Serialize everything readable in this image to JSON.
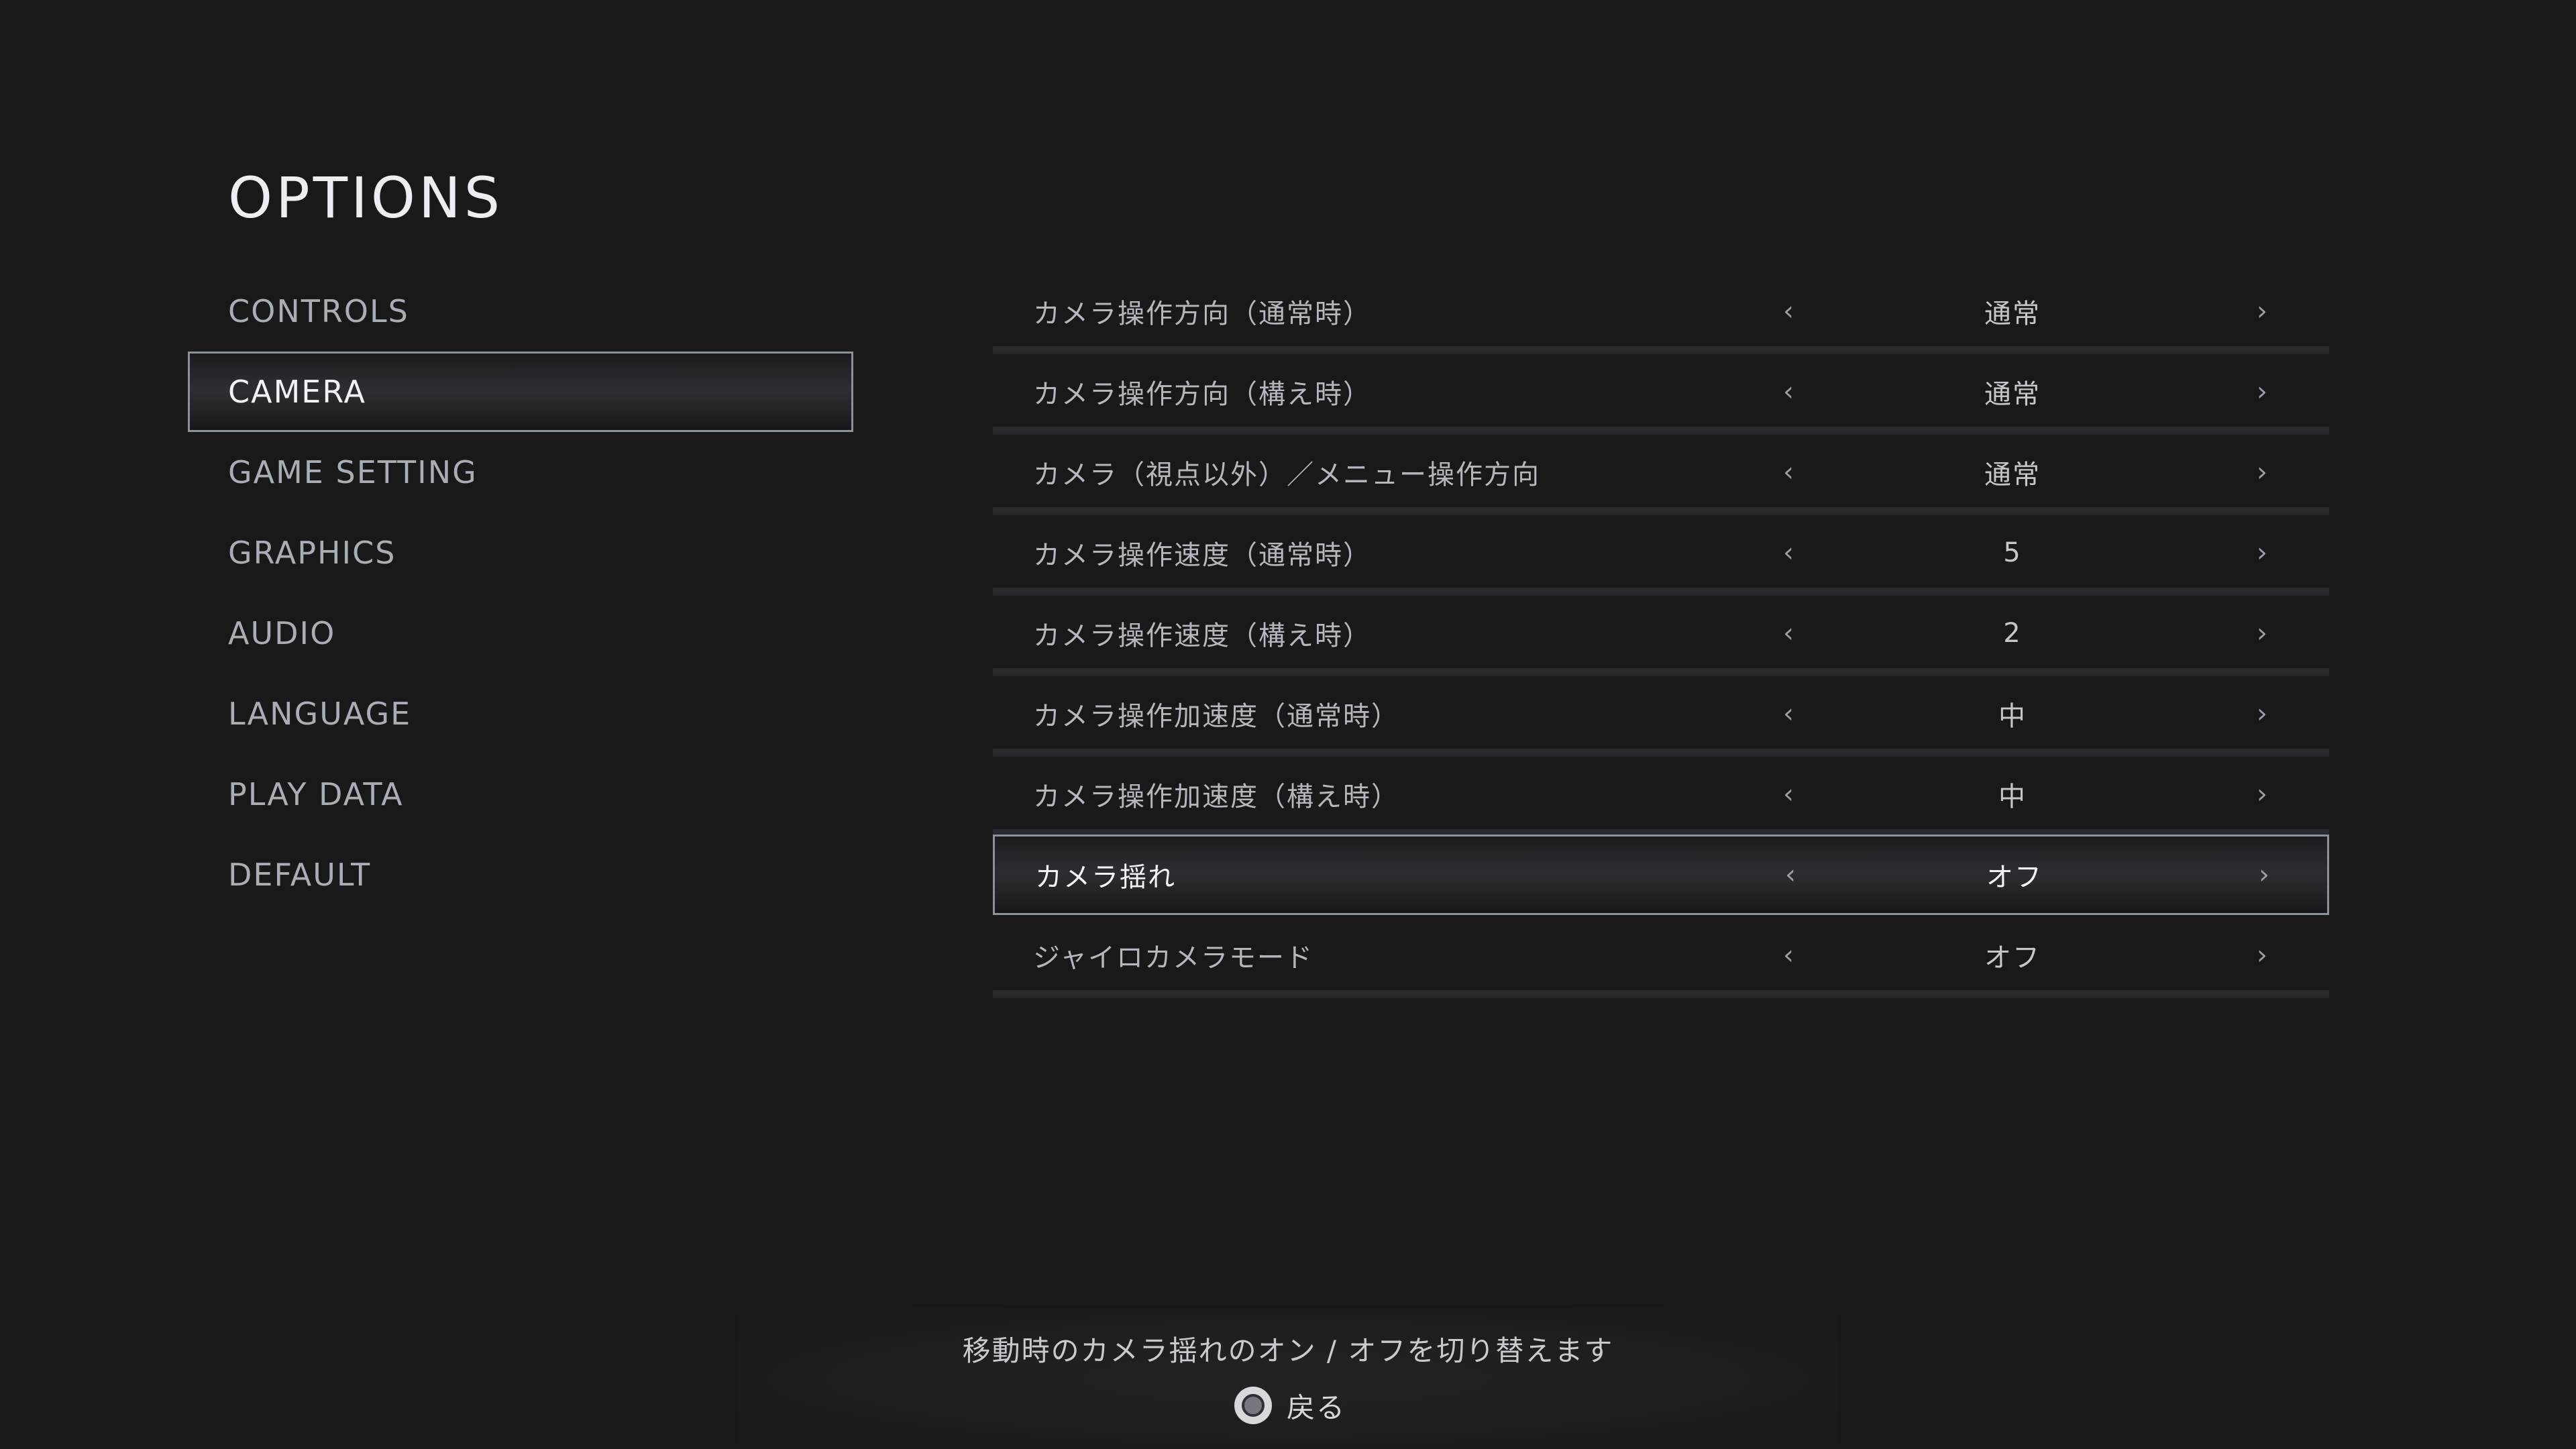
{
  "header": {
    "title": "OPTIONS"
  },
  "menu": {
    "items": [
      {
        "label": "CONTROLS"
      },
      {
        "label": "CAMERA"
      },
      {
        "label": "GAME SETTING"
      },
      {
        "label": "GRAPHICS"
      },
      {
        "label": "AUDIO"
      },
      {
        "label": "LANGUAGE"
      },
      {
        "label": "PLAY DATA"
      },
      {
        "label": "DEFAULT"
      }
    ],
    "selected": "CAMERA"
  },
  "settings": {
    "arrow_left": "‹",
    "arrow_right": "›",
    "rows": [
      {
        "label": "カメラ操作方向（通常時）",
        "value": "通常"
      },
      {
        "label": "カメラ操作方向（構え時）",
        "value": "通常"
      },
      {
        "label": "カメラ（視点以外）／メニュー操作方向",
        "value": "通常"
      },
      {
        "label": "カメラ操作速度（通常時）",
        "value": "5"
      },
      {
        "label": "カメラ操作速度（構え時）",
        "value": "2"
      },
      {
        "label": "カメラ操作加速度（通常時）",
        "value": "中"
      },
      {
        "label": "カメラ操作加速度（構え時）",
        "value": "中"
      },
      {
        "label": "カメラ揺れ",
        "value": "オフ"
      },
      {
        "label": "ジャイロカメラモード",
        "value": "オフ"
      }
    ],
    "selected": "カメラ揺れ"
  },
  "footer": {
    "hint": "移動時のカメラ揺れのオン / オフを切り替えます",
    "back_label": "戻る",
    "back_icon": "circle-button-icon"
  }
}
